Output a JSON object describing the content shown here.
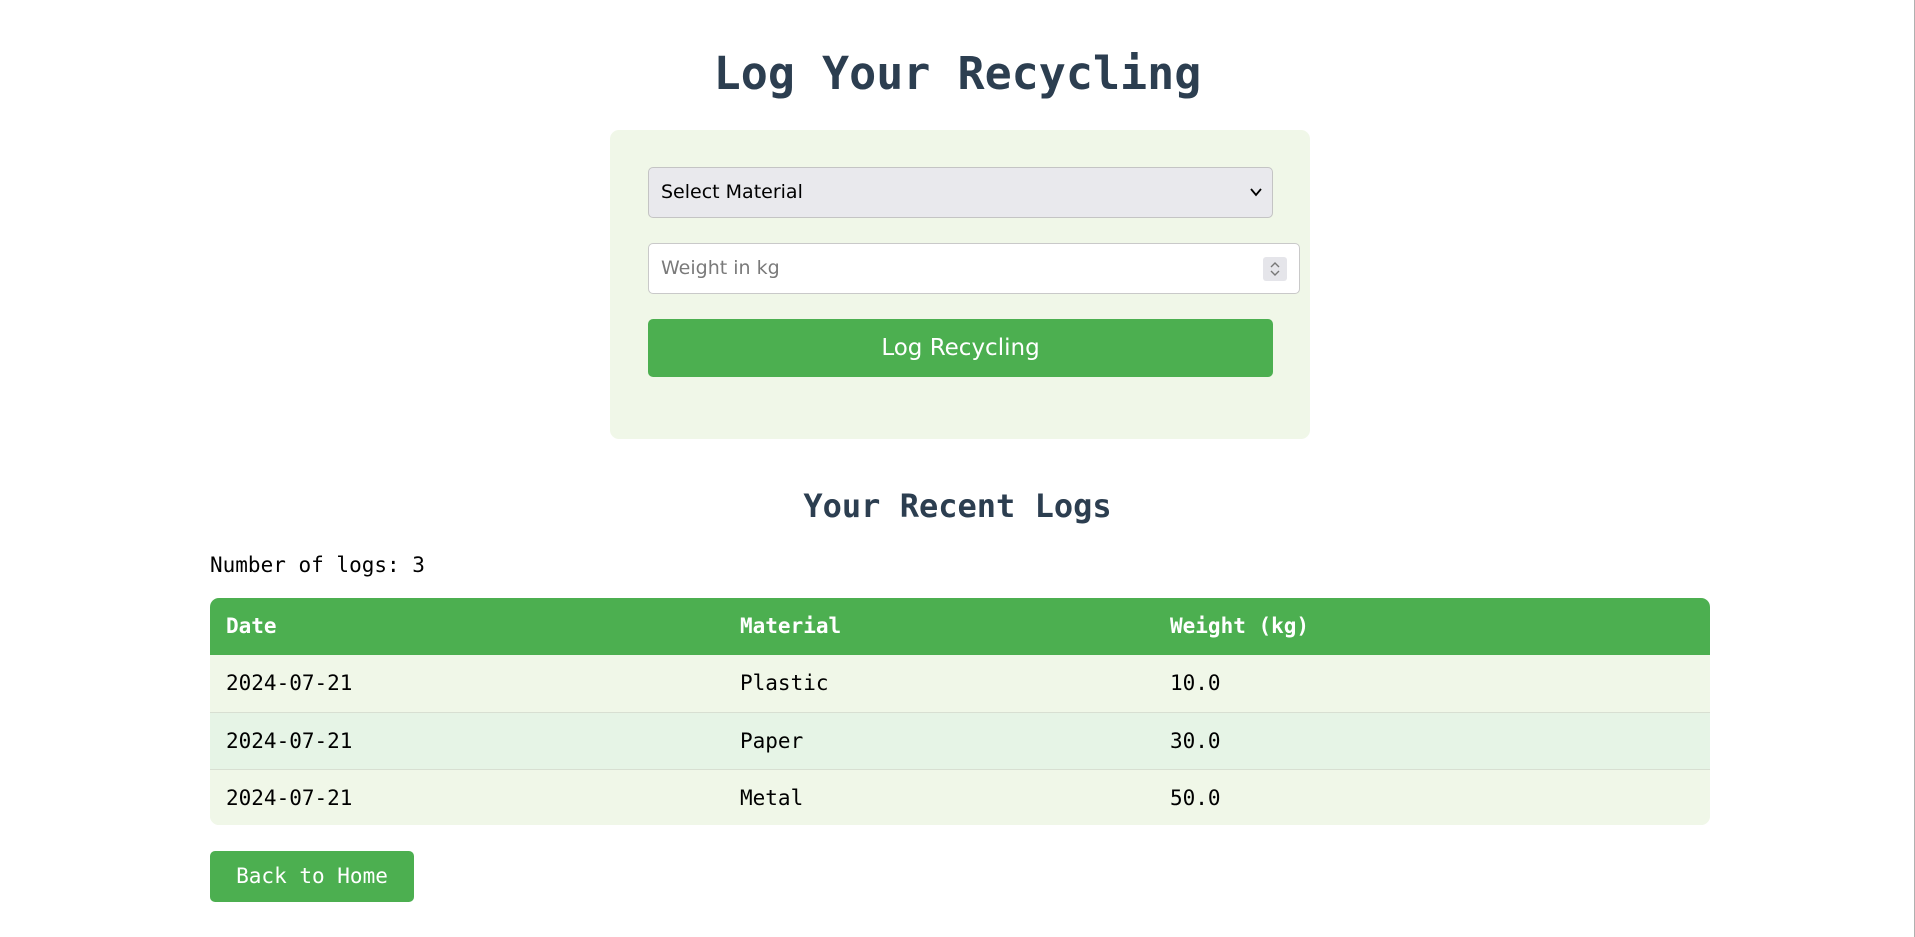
{
  "page": {
    "title": "Log Your Recycling"
  },
  "form": {
    "material_select": {
      "selected": "Select Material"
    },
    "weight_input": {
      "placeholder": "Weight in kg",
      "value": ""
    },
    "submit_label": "Log Recycling"
  },
  "logs": {
    "title": "Your Recent Logs",
    "count_text": "Number of logs: 3",
    "columns": [
      "Date",
      "Material",
      "Weight (kg)"
    ],
    "rows": [
      [
        "2024-07-21",
        "Plastic",
        "10.0"
      ],
      [
        "2024-07-21",
        "Paper",
        "30.0"
      ],
      [
        "2024-07-21",
        "Metal",
        "50.0"
      ]
    ]
  },
  "nav": {
    "back_label": "Back to Home"
  },
  "colors": {
    "accent": "#4caf50",
    "heading": "#2c3e50",
    "card_bg": "#f0f7e8"
  },
  "icons": {
    "select_chevron": "chevron-down-icon",
    "number_spinner": "spinner-icon"
  }
}
